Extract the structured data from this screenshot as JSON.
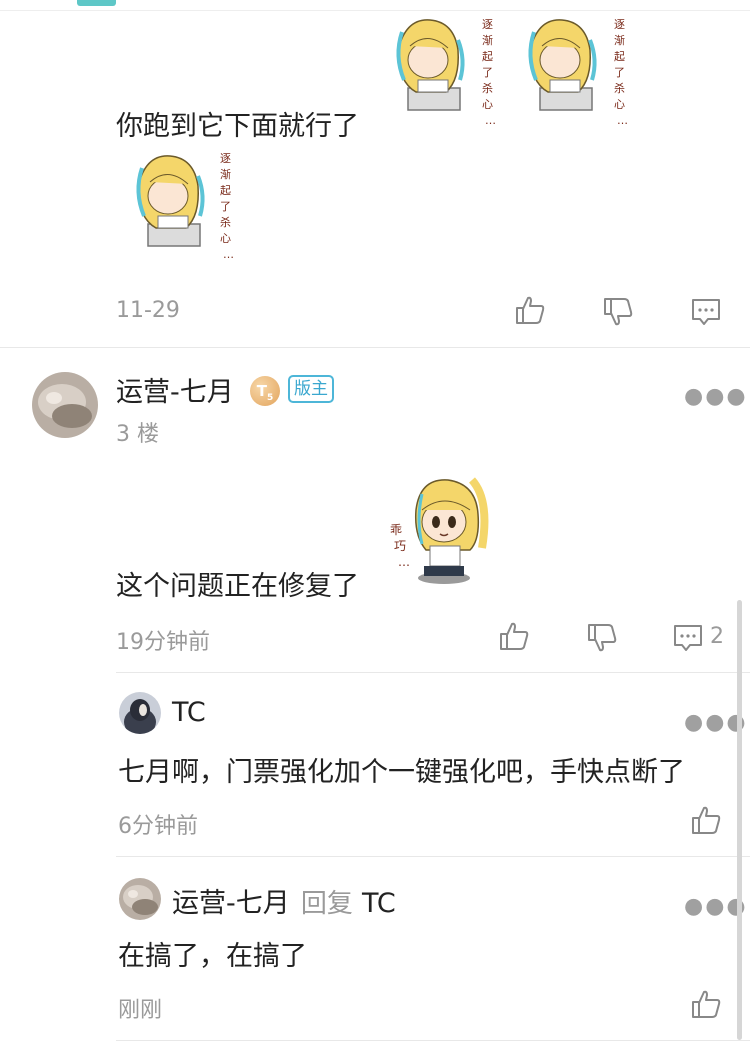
{
  "comment_prev": {
    "text": "你跑到它下面就行了",
    "time": "11-29",
    "sticker_caption": "逐渐起了杀心…"
  },
  "comment_main": {
    "username": "运营-七月",
    "level": "T",
    "level_sub": "5",
    "mod_badge": "版主",
    "floor": "3 楼",
    "text": "这个问题正在修复了",
    "time": "19分钟前",
    "reply_count": "2",
    "sticker_caption": "乖巧…"
  },
  "replies": [
    {
      "username": "TC",
      "text": "七月啊，门票强化加个一键强化吧，手快点断了",
      "time": "6分钟前"
    },
    {
      "username": "运营-七月",
      "reply_label": "回复",
      "reply_target": "TC",
      "text": "在搞了，在搞了",
      "time": "刚刚"
    }
  ],
  "icons": {
    "like": "thumbs-up-icon",
    "dislike": "thumbs-down-icon",
    "comment": "comment-icon",
    "more": "more-icon"
  },
  "colors": {
    "accent": "#5ec7c7",
    "mod_badge": "#3aa7cf",
    "meta_text": "#9a9a9a"
  }
}
